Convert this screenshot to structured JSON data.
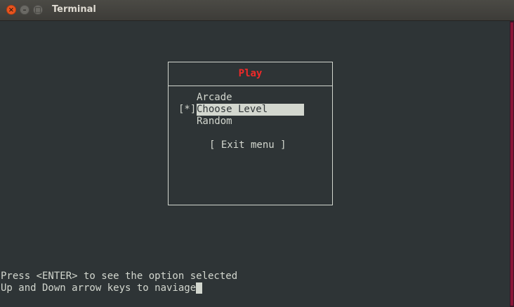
{
  "window": {
    "title": "Terminal"
  },
  "dialog": {
    "title": "Play",
    "options": [
      "Arcade",
      "Choose Level",
      "Random"
    ],
    "selected_marker": "[*]",
    "exit_label": "[ Exit menu ]"
  },
  "status": {
    "line1": "Press <ENTER> to see the option selected",
    "line2": "Up and Down arrow keys to naviage"
  },
  "colors": {
    "background": "#2e3436",
    "text": "#d3d7cf",
    "dialog_title": "#ef2929",
    "close_button": "#e9541f"
  }
}
